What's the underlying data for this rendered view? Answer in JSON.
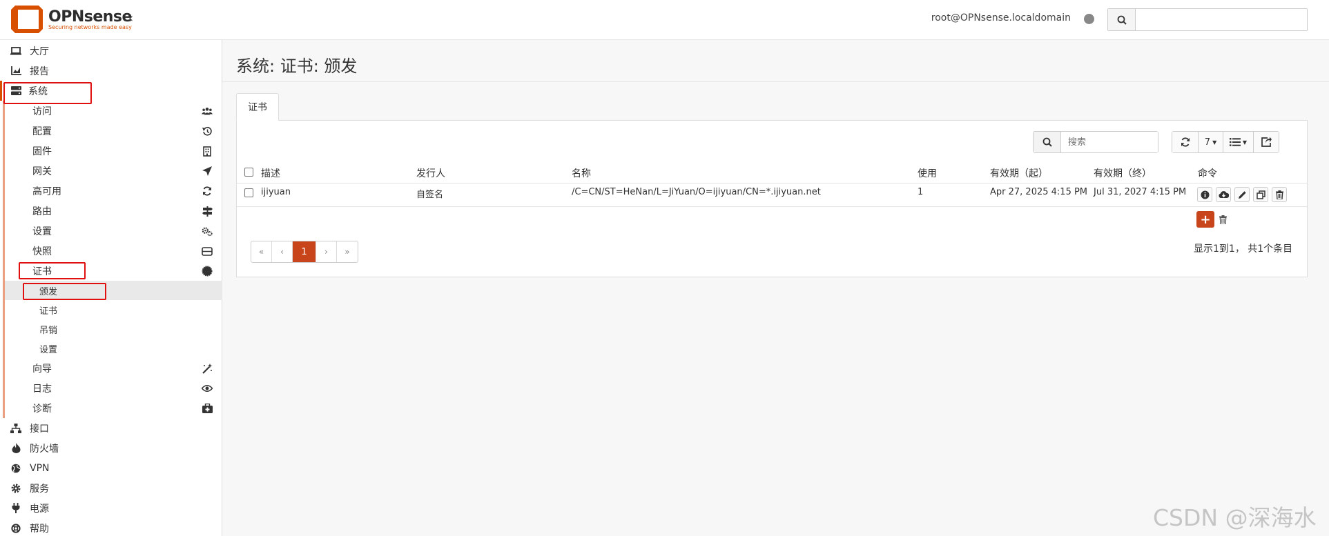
{
  "header": {
    "logo_title": "OPNsense",
    "logo_tagline": "Securing networks made easy",
    "user": "root@OPNsense.localdomain",
    "search_placeholder": "",
    "accent": "#d94f00"
  },
  "sidebar": {
    "top_items": [
      {
        "label": "大厅",
        "icon": "laptop-icon"
      },
      {
        "label": "报告",
        "icon": "chart-icon"
      },
      {
        "label": "系统",
        "icon": "server-icon"
      }
    ],
    "system_items": [
      {
        "label": "访问",
        "icon": "users-icon"
      },
      {
        "label": "配置",
        "icon": "history-icon"
      },
      {
        "label": "固件",
        "icon": "building-icon"
      },
      {
        "label": "网关",
        "icon": "location-arrow-icon"
      },
      {
        "label": "高可用",
        "icon": "refresh-icon"
      },
      {
        "label": "路由",
        "icon": "signpost-icon"
      },
      {
        "label": "设置",
        "icon": "cogs-icon"
      },
      {
        "label": "快照",
        "icon": "hdd-icon"
      },
      {
        "label": "证书",
        "icon": "certificate-icon"
      }
    ],
    "cert_items": [
      {
        "label": "颁发",
        "active": true
      },
      {
        "label": "证书",
        "active": false
      },
      {
        "label": "吊销",
        "active": false
      },
      {
        "label": "设置",
        "active": false
      }
    ],
    "system_items_after": [
      {
        "label": "向导",
        "icon": "magic-icon"
      },
      {
        "label": "日志",
        "icon": "eye-icon"
      },
      {
        "label": "诊断",
        "icon": "medkit-icon"
      }
    ],
    "bottom_items": [
      {
        "label": "接口",
        "icon": "sitemap-icon"
      },
      {
        "label": "防火墙",
        "icon": "fire-icon"
      },
      {
        "label": "VPN",
        "icon": "globe-icon"
      },
      {
        "label": "服务",
        "icon": "cog-icon"
      },
      {
        "label": "电源",
        "icon": "plug-icon"
      },
      {
        "label": "帮助",
        "icon": "lifebuoy-icon"
      }
    ]
  },
  "main": {
    "page_title": "系统: 证书: 颁发",
    "tab_label": "证书",
    "search_placeholder": "搜索",
    "rows_per_page": "7",
    "columns": [
      "描述",
      "发行人",
      "名称",
      "使用",
      "有效期（起）",
      "有效期（终）",
      "命令"
    ],
    "rows": [
      {
        "description": "ijiyuan",
        "issuer": "自签名",
        "name": "/C=CN/ST=HeNan/L=JiYuan/O=ijiyuan/CN=*.ijiyuan.net",
        "usage": "1",
        "valid_from": "Apr 27, 2025 4:15 PM",
        "valid_to": "Jul 31, 2027 4:15 PM"
      }
    ],
    "pagination": {
      "first": "«",
      "prev": "‹",
      "current": "1",
      "next": "›",
      "last": "»"
    },
    "info": "显示1到1， 共1个条目"
  },
  "watermark": "CSDN @深海水"
}
